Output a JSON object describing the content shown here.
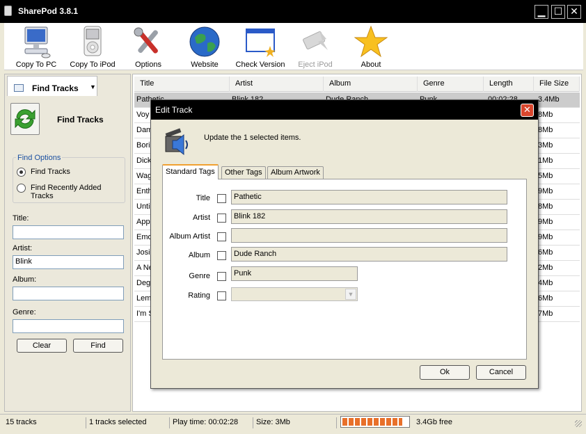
{
  "app": {
    "title": "SharePod 3.8.1"
  },
  "window_controls": {
    "minimize": "▁",
    "maximize": "☐",
    "close": "✕"
  },
  "toolbar": {
    "items": [
      {
        "label": "Copy To PC",
        "icon": "computer-icon"
      },
      {
        "label": "Copy To iPod",
        "icon": "ipod-icon"
      },
      {
        "label": "Options",
        "icon": "tools-icon"
      },
      {
        "label": "Website",
        "icon": "globe-icon"
      },
      {
        "label": "Check Version",
        "icon": "window-sparkle-icon"
      },
      {
        "label": "Eject iPod",
        "icon": "eject-icon",
        "disabled": true
      },
      {
        "label": "About",
        "icon": "star-icon"
      }
    ]
  },
  "left_panel": {
    "header": "Find Tracks",
    "big_button_label": "Find Tracks",
    "options_legend": "Find Options",
    "options": [
      {
        "label": "Find Tracks",
        "selected": true
      },
      {
        "label": "Find Recently Added Tracks",
        "selected": false
      }
    ],
    "fields": {
      "title_label": "Title:",
      "title_value": "",
      "artist_label": "Artist:",
      "artist_value": "Blink",
      "album_label": "Album:",
      "album_value": "",
      "genre_label": "Genre:",
      "genre_value": ""
    },
    "clear_label": "Clear",
    "find_label": "Find"
  },
  "table": {
    "columns": [
      "Title",
      "Artist",
      "Album",
      "Genre",
      "Length",
      "File Size"
    ],
    "rows": [
      {
        "title": "Pathetic",
        "artist": "Blink 182",
        "album": "Dude Ranch",
        "genre": "Punk",
        "length": "00:02:28",
        "size": "3.4Mb"
      },
      {
        "title": "Voy",
        "size": "8Mb"
      },
      {
        "title": "Dam",
        "size": "8Mb"
      },
      {
        "title": "Borin",
        "size": "3Mb"
      },
      {
        "title": "Dick",
        "size": "1Mb"
      },
      {
        "title": "Wag",
        "size": "5Mb"
      },
      {
        "title": "Enth",
        "size": "9Mb"
      },
      {
        "title": "Unti",
        "size": "8Mb"
      },
      {
        "title": "App",
        "size": "9Mb"
      },
      {
        "title": "Emo",
        "size": "9Mb"
      },
      {
        "title": "Josie",
        "size": "6Mb"
      },
      {
        "title": "A Ne",
        "size": "2Mb"
      },
      {
        "title": "Deg",
        "size": "4Mb"
      },
      {
        "title": "Lem",
        "size": "6Mb"
      },
      {
        "title": "I'm S",
        "size": "7Mb"
      }
    ]
  },
  "status": {
    "tracks": "15 tracks",
    "selected": "1 tracks selected",
    "play_time": "Play time: 00:02:28",
    "size": "Size: 3Mb",
    "free": "3.4Gb free",
    "usage_fraction": 0.92
  },
  "dialog": {
    "title": "Edit Track",
    "close": "✕",
    "message": "Update the 1 selected items.",
    "tabs": [
      "Standard Tags",
      "Other Tags",
      "Album Artwork"
    ],
    "active_tab": "Standard Tags",
    "fields": {
      "title_label": "Title",
      "title_value": "Pathetic",
      "artist_label": "Artist",
      "artist_value": "Blink 182",
      "album_artist_label": "Album Artist",
      "album_artist_value": "",
      "album_label": "Album",
      "album_value": "Dude Ranch",
      "genre_label": "Genre",
      "genre_value": "Punk",
      "rating_label": "Rating",
      "rating_value": ""
    },
    "ok_label": "Ok",
    "cancel_label": "Cancel"
  }
}
